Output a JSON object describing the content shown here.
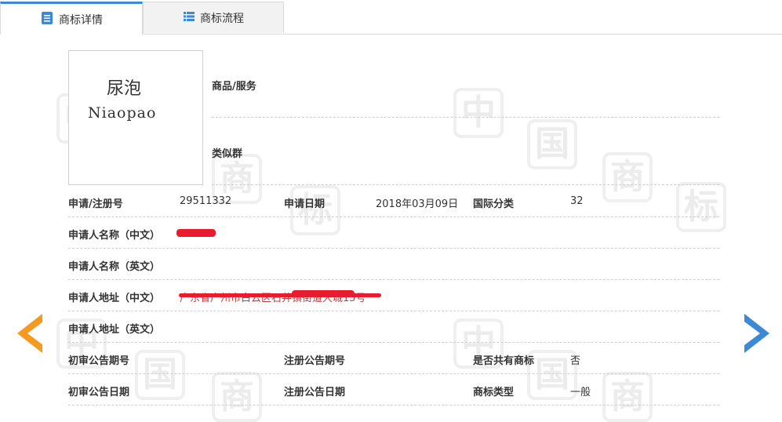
{
  "tabs": [
    {
      "label": "商标详情",
      "icon": "document-list-icon"
    },
    {
      "label": "商标流程",
      "icon": "list-icon"
    }
  ],
  "mark_image": {
    "chinese": "尿泡",
    "english": "Niaopao"
  },
  "goods_label": "商品/服务",
  "similar_label": "类似群",
  "fields": {
    "reg_no_label": "申请/注册号",
    "reg_no": "29511332",
    "apply_date_label": "申请日期",
    "apply_date": "2018年03月09日",
    "intl_class_label": "国际分类",
    "intl_class": "32",
    "applicant_cn_label": "申请人名称（中文）",
    "applicant_en_label": "申请人名称（英文）",
    "address_cn_label": "申请人地址（中文）",
    "address_cn": "广东省广州市白云区石井镇街道大城15号",
    "address_en_label": "申请人地址（英文）",
    "prelim_no_label": "初审公告期号",
    "reg_pub_no_label": "注册公告期号",
    "shared_label": "是否共有商标",
    "shared": "否",
    "prelim_date_label": "初审公告日期",
    "reg_pub_date_label": "注册公告日期",
    "type_label": "商标类型",
    "type": "一般"
  },
  "watermark": "中国商标",
  "colors": {
    "accent": "#3b88d4",
    "prev_arrow": "#f59a1e",
    "redaction": "#e81c2e"
  }
}
